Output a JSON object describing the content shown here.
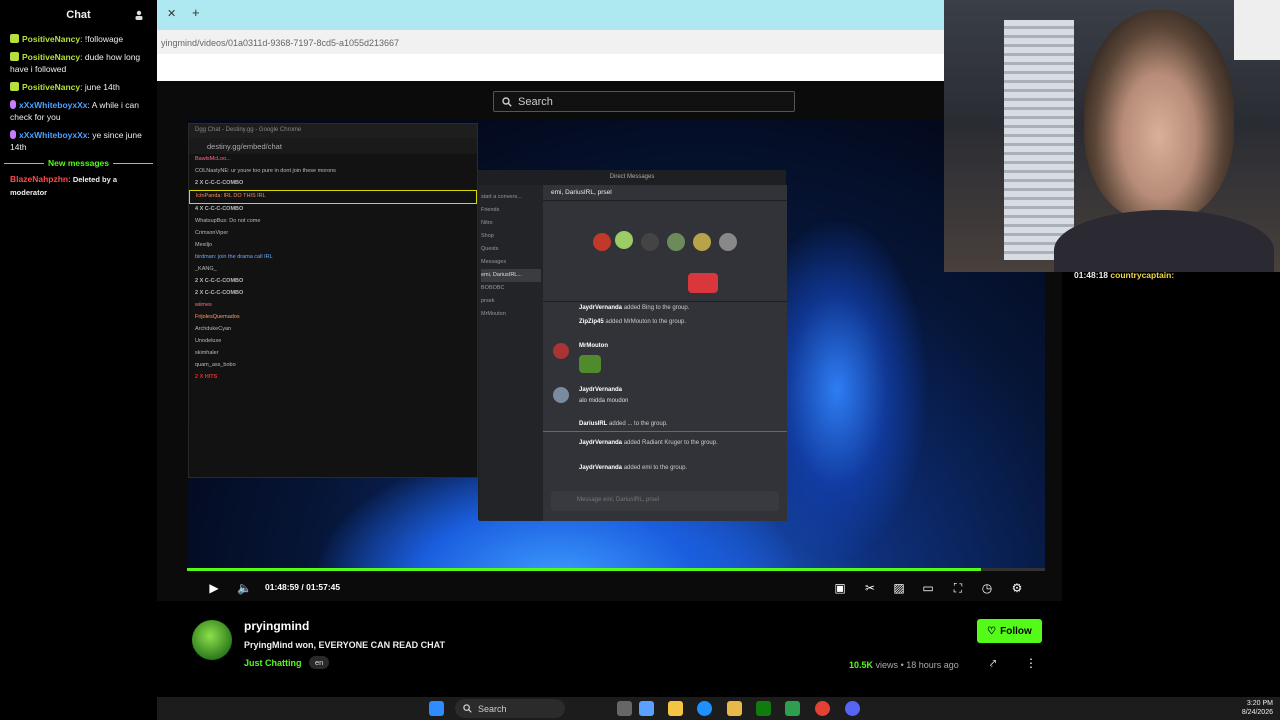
{
  "chat": {
    "title": "Chat",
    "messages": [
      {
        "user": "PositiveNancy",
        "text": "!followage"
      },
      {
        "user": "PositiveNancy",
        "text": "dude how long have i followed"
      },
      {
        "user": "PositiveNancy",
        "text": "june 14th"
      },
      {
        "user": "xXxWhiteboyxXx",
        "text": "A while i can check for you"
      },
      {
        "user": "xXxWhiteboyxXx",
        "text": "ye since june 14th"
      }
    ],
    "new_messages": "New messages",
    "deleted": {
      "user": "BlazeNahpzhn",
      "text": "Deleted by a moderator"
    }
  },
  "browser": {
    "url": "yingmind/videos/01a0311d-9368-7197-8cd5-a1055d213667",
    "search_placeholder": "Search"
  },
  "video_content": {
    "dgg_title": "Dgg Chat - Destiny.gg - Google Chrome",
    "dgg_url": "destiny.gg/embed/chat",
    "dgg_lines": [
      "BawlsMcLoo...",
      "COLNastyNE: ur youre too pure in dont join these morons",
      "2 X C-C-C-COMBO",
      "lctnPanda: IRL DO THIS IRL",
      "4 X C-C-C-COMBO",
      "WhatsupBus: Do not come",
      "CrimsonViper",
      "Mexiljo",
      "birdman: join the drama call IRL",
      "_KANG_",
      "2 X C-C-C-COMBO",
      "2 X C-C-C-COMBO",
      "wiimes",
      "FrijolesQuemados",
      "ArchdukeCyan",
      "Unodeluxe",
      "skimhaler",
      "quam_ass_bobo",
      "2 X HITS"
    ],
    "dm_title": "Direct Messages",
    "dm_channel": "emi, DariusIRL, prsel",
    "dm_side": [
      "start a convers...",
      "Friends",
      "Nitro",
      "Shop",
      "Quests",
      "Messages",
      "emi, DariusIRL...",
      "BOBOBC",
      "prsek",
      "MrMouton"
    ],
    "dm_lines": [
      {
        "name": "JaydrVernanda",
        "text": "added Bing to the group."
      },
      {
        "name": "ZipZip45",
        "text": "added MrMouton to the group."
      },
      {
        "name": "MrMouton",
        "text": ""
      },
      {
        "name": "JaydrVernanda",
        "text": "alo midda moudon"
      },
      {
        "name": "DariusIRL",
        "text": "added ... to the group."
      },
      {
        "name": "JaydrVernanda",
        "text": "added Radiant Kruger to the group."
      },
      {
        "name": "JaydrVernanda",
        "text": "added emi to the group."
      }
    ],
    "dm_input": "Message emi, DariusIRL, prsel"
  },
  "player": {
    "time": "01:48:59 / 01:57:45",
    "progress": 0.925
  },
  "stream": {
    "channel": "pryingmind",
    "title": "PryingMind won, EVERYONE CAN READ CHAT",
    "category": "Just Chatting",
    "language": "en",
    "follow": "Follow",
    "views": "10.5K",
    "views_label": "views",
    "age": "18 hours ago"
  },
  "right_chat": {
    "time": "01:48:18",
    "user": "countrycaptain:"
  },
  "taskbar": {
    "search": "Search",
    "time": "3:20 PM",
    "date": "8/24/2026"
  },
  "colors": {
    "accent": "#53fc18",
    "tab_bar": "#aee9f1"
  }
}
